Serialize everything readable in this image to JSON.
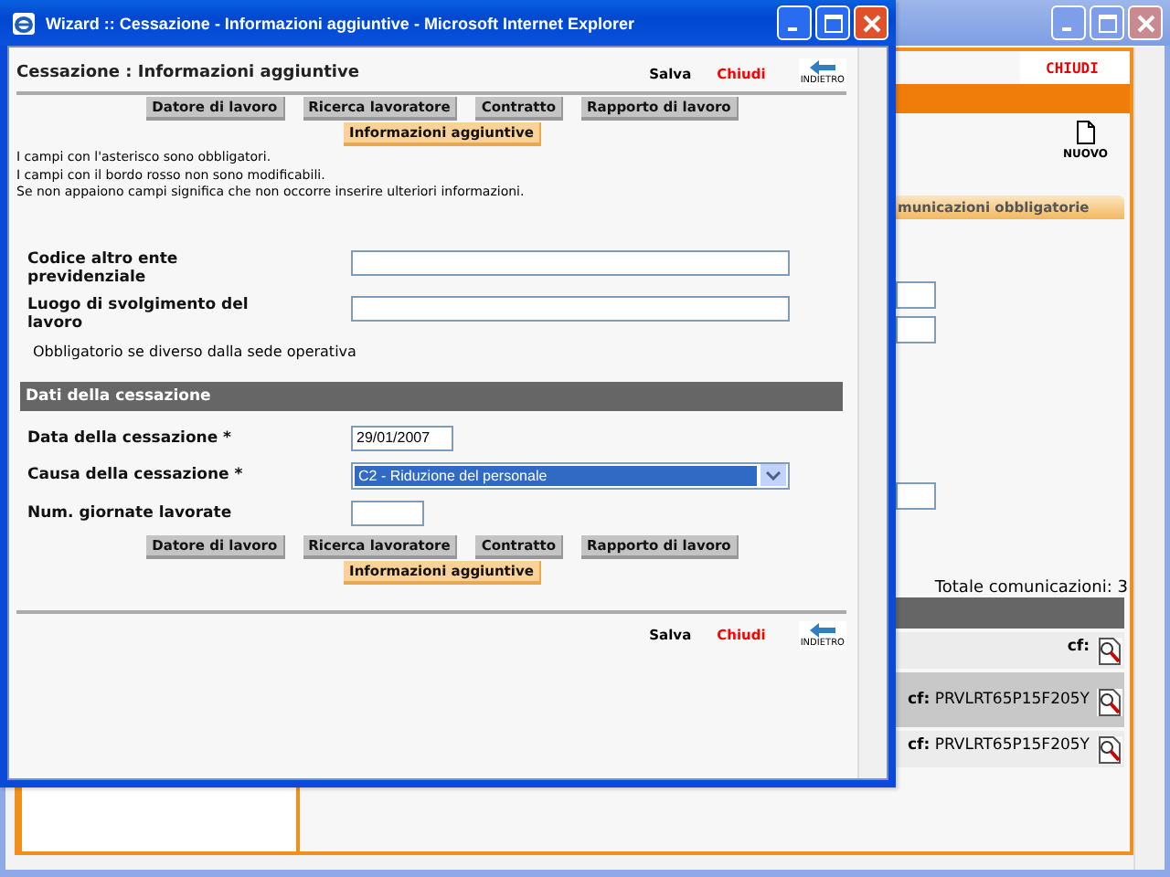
{
  "background_window": {
    "close_link": "CHIUDI",
    "new_button": "NUOVO",
    "tab": {
      "label": "municazioni obbligatorie",
      "selected": true
    },
    "total": "Totale comunicazioni: 3",
    "rows": [
      {
        "label": "cf:",
        "selected": false
      },
      {
        "label": "cf:",
        "value": "PRVLRT65P15F205Y",
        "selected": true
      },
      {
        "label": "cf:",
        "value": "PRVLRT65P15F205Y",
        "selected": false
      }
    ]
  },
  "popup": {
    "window": {
      "title": "Wizard :: Cessazione - Informazioni aggiuntive - Microsoft Internet Explorer"
    },
    "header": {
      "title": "Cessazione : Informazioni aggiuntive",
      "save": "Salva",
      "close": "Chiudi",
      "back": "INDIETRO"
    },
    "steps_top": [
      {
        "label": "Datore di lavoro",
        "selected": false
      },
      {
        "label": "Ricerca lavoratore",
        "selected": false
      },
      {
        "label": "Contratto",
        "selected": false
      },
      {
        "label": "Rapporto di lavoro",
        "selected": false
      },
      {
        "label": "Informazioni aggiuntive",
        "selected": true
      }
    ],
    "notes": [
      "I campi con l'asterisco sono obbligatori.",
      "I campi con il bordo rosso non sono modificabili.",
      "Se non appaiono campi significa che non occorre inserire ulteriori informazioni."
    ],
    "fields": [
      {
        "kind": "text",
        "label": "Codice altro ente previdenziale"
      },
      {
        "kind": "text",
        "label": "Luogo di svolgimento del lavoro"
      }
    ],
    "hint": "Obbligatorio se diverso dalla sede operativa",
    "section": {
      "title": "Dati della cessazione",
      "fields": [
        {
          "kind": "date",
          "label": "Data della cessazione *",
          "value": "29/01/2007"
        },
        {
          "kind": "select",
          "label": "Causa della cessazione *",
          "value": "C2 - Riduzione del personale"
        },
        {
          "kind": "number",
          "label": "Num. giornate lavorate"
        }
      ]
    },
    "steps_bottom": [
      {
        "label": "Datore di lavoro",
        "selected": false
      },
      {
        "label": "Ricerca lavoratore",
        "selected": false
      },
      {
        "label": "Contratto",
        "selected": false
      },
      {
        "label": "Rapporto di lavoro",
        "selected": false
      },
      {
        "label": "Informazioni aggiuntive",
        "selected": true
      }
    ],
    "footer": {
      "save": "Salva",
      "close": "Chiudi",
      "back": "INDIETRO"
    }
  }
}
